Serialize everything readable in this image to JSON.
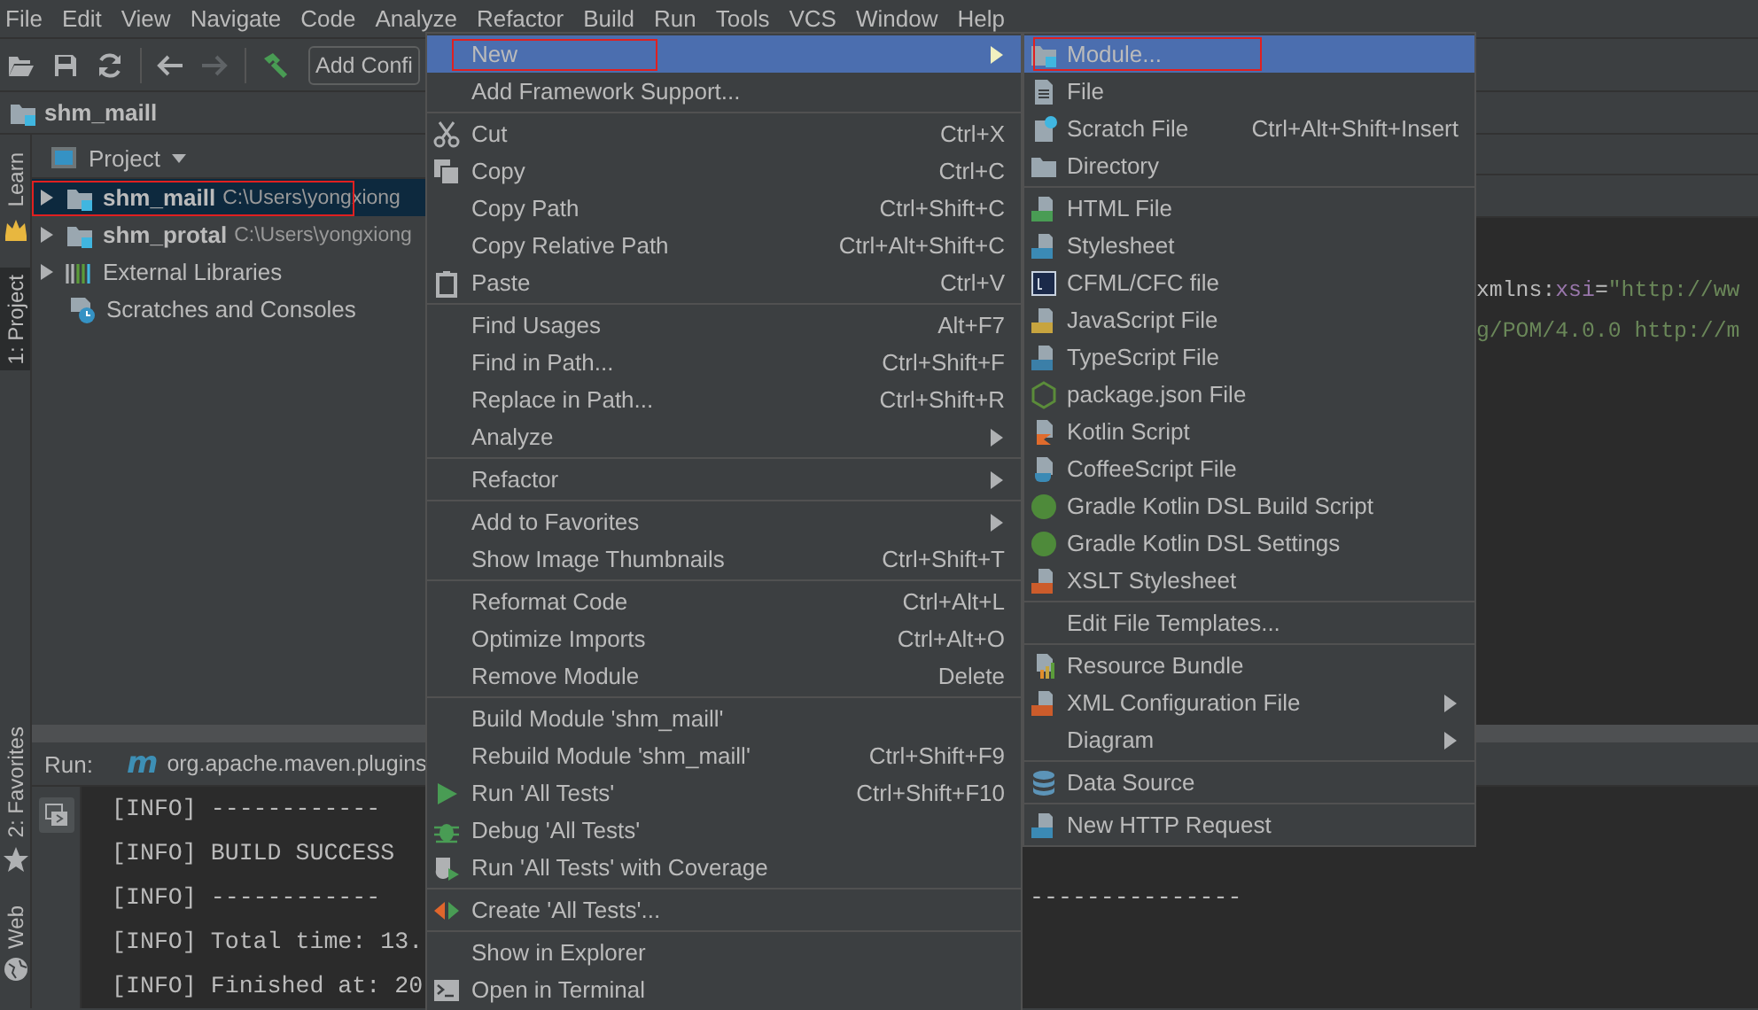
{
  "menu_bar": [
    "File",
    "Edit",
    "View",
    "Navigate",
    "Code",
    "Analyze",
    "Refactor",
    "Build",
    "Run",
    "Tools",
    "VCS",
    "Window",
    "Help"
  ],
  "toolbar": {
    "nav_buttons": [
      {
        "disabled": false
      },
      {
        "disabled": true
      }
    ],
    "run_config": "Add Confi"
  },
  "breadcrumb": "shm_maill",
  "left_stripe": {
    "top": [
      {
        "label": "Learn",
        "selected": false
      },
      {
        "label": "1: Project",
        "selected": true
      }
    ],
    "bottom": [
      {
        "label": "2: Favorites",
        "selected": false
      },
      {
        "label": "Web",
        "selected": false
      }
    ]
  },
  "project_panel": {
    "title": "Project",
    "tree": [
      {
        "kind": "module",
        "name": "shm_maill",
        "path": "C:\\Users\\yongxiong",
        "expanded": false,
        "selected": true,
        "outlined": true
      },
      {
        "kind": "module",
        "name": "shm_protal",
        "path": "C:\\Users\\yongxiong",
        "expanded": false,
        "selected": false,
        "outlined": false
      },
      {
        "kind": "library",
        "name": "External Libraries",
        "expanded": false,
        "selected": false,
        "outlined": false
      },
      {
        "kind": "scratches",
        "name": "Scratches and Consoles",
        "selected": false,
        "outlined": false
      }
    ]
  },
  "editor": {
    "code_lines": [
      {
        "tokens": [
          {
            "kind": "attr",
            "text": "xmlns"
          },
          {
            "kind": "plain",
            "text": ":"
          },
          {
            "kind": "ns",
            "text": "xsi"
          },
          {
            "kind": "plain",
            "text": "="
          },
          {
            "kind": "string",
            "text": "\"http://ww"
          }
        ]
      },
      {
        "tokens": [
          {
            "kind": "string",
            "text": "g/POM/4.0.0 http://m"
          }
        ]
      }
    ]
  },
  "run_panel": {
    "label": "Run:",
    "tool_logo": "m",
    "tab": "org.apache.maven.plugins",
    "console": [
      {
        "text": "[INFO] ------------"
      },
      {
        "text": "[INFO] BUILD SUCCESS"
      },
      {
        "text": "[INFO] ------------",
        "tail": "---------------"
      },
      {
        "text": "[INFO] Total time: 13."
      },
      {
        "text": "[INFO] Finished at: 20"
      }
    ]
  },
  "context_menu": {
    "groups": [
      [
        {
          "label": "New",
          "submenu": true,
          "selected": true,
          "outlined": true
        },
        {
          "label": "Add Framework Support...",
          "selected": false,
          "outlined": false
        }
      ],
      [
        {
          "label": "Cut",
          "shortcut": "Ctrl+X",
          "selected": false,
          "outlined": false
        },
        {
          "label": "Copy",
          "shortcut": "Ctrl+C",
          "selected": false,
          "outlined": false
        },
        {
          "label": "Copy Path",
          "shortcut": "Ctrl+Shift+C",
          "selected": false,
          "outlined": false
        },
        {
          "label": "Copy Relative Path",
          "shortcut": "Ctrl+Alt+Shift+C",
          "selected": false,
          "outlined": false
        },
        {
          "label": "Paste",
          "shortcut": "Ctrl+V",
          "selected": false,
          "outlined": false
        }
      ],
      [
        {
          "label": "Find Usages",
          "shortcut": "Alt+F7",
          "selected": false,
          "outlined": false
        },
        {
          "label": "Find in Path...",
          "shortcut": "Ctrl+Shift+F",
          "selected": false,
          "outlined": false
        },
        {
          "label": "Replace in Path...",
          "shortcut": "Ctrl+Shift+R",
          "selected": false,
          "outlined": false
        },
        {
          "label": "Analyze",
          "submenu": true,
          "selected": false,
          "outlined": false
        }
      ],
      [
        {
          "label": "Refactor",
          "submenu": true,
          "selected": false,
          "outlined": false
        }
      ],
      [
        {
          "label": "Add to Favorites",
          "submenu": true,
          "selected": false,
          "outlined": false
        },
        {
          "label": "Show Image Thumbnails",
          "shortcut": "Ctrl+Shift+T",
          "selected": false,
          "outlined": false
        }
      ],
      [
        {
          "label": "Reformat Code",
          "shortcut": "Ctrl+Alt+L",
          "selected": false,
          "outlined": false
        },
        {
          "label": "Optimize Imports",
          "shortcut": "Ctrl+Alt+O",
          "selected": false,
          "outlined": false
        },
        {
          "label": "Remove Module",
          "shortcut": "Delete",
          "selected": false,
          "outlined": false
        }
      ],
      [
        {
          "label": "Build Module 'shm_maill'",
          "selected": false,
          "outlined": false
        },
        {
          "label": "Rebuild Module 'shm_maill'",
          "shortcut": "Ctrl+Shift+F9",
          "selected": false,
          "outlined": false
        },
        {
          "label": "Run 'All Tests'",
          "shortcut": "Ctrl+Shift+F10",
          "selected": false,
          "outlined": false
        },
        {
          "label": "Debug 'All Tests'",
          "selected": false,
          "outlined": false
        },
        {
          "label": "Run 'All Tests' with Coverage",
          "selected": false,
          "outlined": false
        }
      ],
      [
        {
          "label": "Create 'All Tests'...",
          "selected": false,
          "outlined": false
        }
      ],
      [
        {
          "label": "Show in Explorer",
          "selected": false,
          "outlined": false
        },
        {
          "label": "Open in Terminal",
          "selected": false,
          "outlined": false
        }
      ]
    ]
  },
  "submenu": {
    "groups": [
      [
        {
          "label": "Module...",
          "selected": true,
          "outlined": true
        },
        {
          "label": "File",
          "selected": false,
          "outlined": false
        },
        {
          "label": "Scratch File",
          "shortcut": "Ctrl+Alt+Shift+Insert",
          "selected": false,
          "outlined": false
        },
        {
          "label": "Directory",
          "selected": false,
          "outlined": false
        }
      ],
      [
        {
          "label": "HTML File",
          "selected": false,
          "outlined": false
        },
        {
          "label": "Stylesheet",
          "selected": false,
          "outlined": false
        },
        {
          "label": "CFML/CFC file",
          "selected": false,
          "outlined": false
        },
        {
          "label": "JavaScript File",
          "selected": false,
          "outlined": false
        },
        {
          "label": "TypeScript File",
          "selected": false,
          "outlined": false
        },
        {
          "label": "package.json File",
          "selected": false,
          "outlined": false
        },
        {
          "label": "Kotlin Script",
          "selected": false,
          "outlined": false
        },
        {
          "label": "CoffeeScript File",
          "selected": false,
          "outlined": false
        },
        {
          "label": "Gradle Kotlin DSL Build Script",
          "selected": false,
          "outlined": false
        },
        {
          "label": "Gradle Kotlin DSL Settings",
          "selected": false,
          "outlined": false
        },
        {
          "label": "XSLT Stylesheet",
          "selected": false,
          "outlined": false
        }
      ],
      [
        {
          "label": "Edit File Templates...",
          "selected": false,
          "outlined": false
        }
      ],
      [
        {
          "label": "Resource Bundle",
          "selected": false,
          "outlined": false
        },
        {
          "label": "XML Configuration File",
          "submenu": true,
          "selected": false,
          "outlined": false
        },
        {
          "label": "Diagram",
          "submenu": true,
          "selected": false,
          "outlined": false
        }
      ],
      [
        {
          "label": "Data Source",
          "selected": false,
          "outlined": false
        }
      ],
      [
        {
          "label": "New HTTP Request",
          "selected": false,
          "outlined": false
        }
      ]
    ]
  }
}
